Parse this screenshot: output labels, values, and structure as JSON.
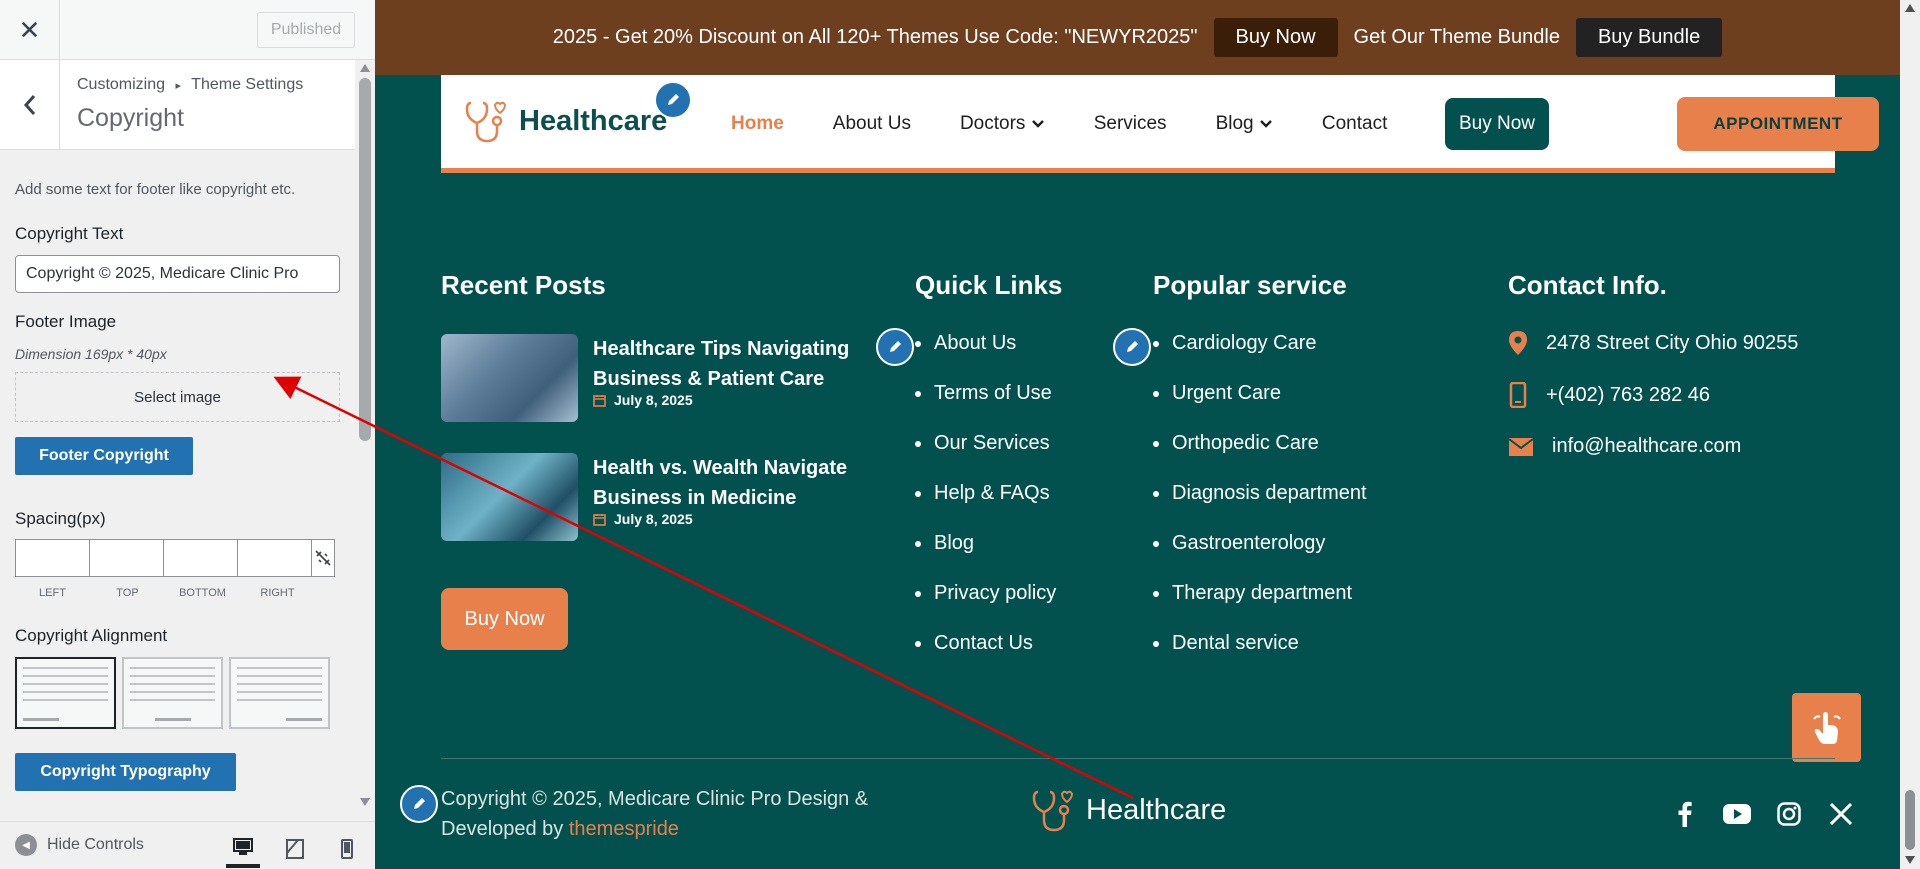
{
  "customizer": {
    "close_symbol": "✕",
    "published_label": "Published",
    "back_symbol": "‹",
    "breadcrumb_root": "Customizing",
    "breadcrumb_sep": "▸",
    "breadcrumb_parent": "Theme Settings",
    "section_title": "Copyright",
    "description": "Add some text for footer like copyright etc.",
    "copyright_text_label": "Copyright Text",
    "copyright_text_value": "Copyright © 2025, Medicare Clinic Pro",
    "footer_image_label": "Footer Image",
    "footer_image_dimension": "Dimension 169px * 40px",
    "select_image_label": "Select image",
    "footer_copyright_button": "Footer Copyright",
    "spacing_label": "Spacing(px)",
    "spacing_fields": [
      "LEFT",
      "TOP",
      "BOTTOM",
      "RIGHT"
    ],
    "alignment_label": "Copyright Alignment",
    "typography_button": "Copyright Typography",
    "hide_controls_label": "Hide Controls"
  },
  "promo": {
    "text": "2025 - Get 20% Discount on All 120+ Themes Use Code: \"NEWYR2025\"",
    "buy_now": "Buy Now",
    "bundle_text": "Get Our Theme Bundle",
    "buy_bundle": "Buy Bundle"
  },
  "header": {
    "logo_text": "Healthcare",
    "nav": [
      "Home",
      "About Us",
      "Doctors",
      "Services",
      "Blog",
      "Contact"
    ],
    "buy_now": "Buy Now",
    "appointment": "APPOINTMENT"
  },
  "footer": {
    "recent_posts_heading": "Recent Posts",
    "posts": [
      {
        "title": "Healthcare Tips Navigating Business & Patient Care",
        "date": "July 8, 2025"
      },
      {
        "title": "Health vs. Wealth Navigate Business in Medicine",
        "date": "July 8, 2025"
      }
    ],
    "buy_now": "Buy Now",
    "quick_links_heading": "Quick Links",
    "quick_links": [
      "About Us",
      "Terms of Use",
      "Our Services",
      "Help & FAQs",
      "Blog",
      "Privacy policy",
      "Contact Us"
    ],
    "popular_heading": "Popular service",
    "popular": [
      "Cardiology Care",
      "Urgent Care",
      "Orthopedic Care",
      "Diagnosis department",
      "Gastroenterology",
      "Therapy department",
      "Dental service"
    ],
    "contact_heading": "Contact Info.",
    "address": "2478 Street City Ohio 90255",
    "phone": "+(402) 763 282 46",
    "email": "info@healthcare.com",
    "copyright_line1": "Copyright © 2025, Medicare Clinic Pro Design &",
    "copyright_line2_prefix": "Developed by ",
    "copyright_link": "themespride",
    "footer_logo_text": "Healthcare"
  },
  "colors": {
    "accent": "#e8804b",
    "primary": "#02514f",
    "wp_blue": "#2271b1",
    "promo_bg": "#6e3f1e"
  }
}
